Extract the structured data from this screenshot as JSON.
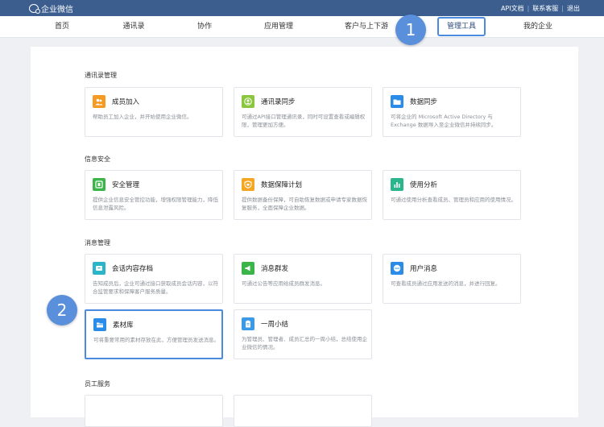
{
  "topbar": {
    "logo_text": "企业微信",
    "links": [
      "API文档",
      "联系客服",
      "退出"
    ],
    "separator": "|"
  },
  "nav": {
    "items": [
      {
        "label": "首页"
      },
      {
        "label": "通讯录"
      },
      {
        "label": "协作"
      },
      {
        "label": "应用管理"
      },
      {
        "label": "客户与上下游"
      },
      {
        "label": "管理工具",
        "active": true
      },
      {
        "label": "我的企业"
      }
    ]
  },
  "sections": [
    {
      "title": "通讯录管理",
      "cards": [
        {
          "title": "成员加入",
          "desc": "帮助员工加入企业，并开始使用企业微信。",
          "icon": "users-icon",
          "color": "#f59a23"
        },
        {
          "title": "通讯录同步",
          "desc": "可通过API接口管理通讯录，同时可设置查看或编辑权限，管理更加方便。",
          "icon": "user-sync-icon",
          "color": "#8cc63f"
        },
        {
          "title": "数据同步",
          "desc": "可将企业的 Microsoft Active Directory 与 Exchange 数据导入至企业微信并持续同步。",
          "icon": "folder-icon",
          "color": "#2a8ce8"
        }
      ]
    },
    {
      "title": "信息安全",
      "cards": [
        {
          "title": "安全管理",
          "desc": "提供企业信息安全管控功能，增强权限管理能力，降低信息泄露风险。",
          "icon": "shield-icon",
          "color": "#3bb54a"
        },
        {
          "title": "数据保障计划",
          "desc": "提供数据备份保障，可自助恢复数据或申请专家数据恢复服务，全面保障企业数据。",
          "icon": "data-shield-icon",
          "color": "#f5a623"
        },
        {
          "title": "使用分析",
          "desc": "可通过使用分析查看成员、管理员和应用的使用情况。",
          "icon": "bar-chart-icon",
          "color": "#2bb58c"
        }
      ]
    },
    {
      "title": "消息管理",
      "cards": [
        {
          "title": "会话内容存档",
          "desc": "告知成员后，企业可通过接口获取成员会话内容，以符合监管要求和保障客户服务质量。",
          "icon": "archive-icon",
          "color": "#2bb5c8"
        },
        {
          "title": "消息群发",
          "desc": "可通过公告等应用给成员群发消息。",
          "icon": "megaphone-icon",
          "color": "#3bb54a"
        },
        {
          "title": "用户消息",
          "desc": "可查看成员通过应用发送的消息，并进行回复。",
          "icon": "chat-icon",
          "color": "#2a8ce8"
        },
        {
          "title": "素材库",
          "desc": "可将重要常用的素材存放在此，方便管理员发送消息。",
          "icon": "library-icon",
          "color": "#2a8ce8",
          "highlight": true
        },
        {
          "title": "一周小结",
          "desc": "为管理员、管理者、成员汇总的一周小结，总结使用企业微信的情况。",
          "icon": "clipboard-icon",
          "color": "#3b9ae8"
        }
      ]
    },
    {
      "title": "员工服务",
      "cards": []
    }
  ],
  "badges": [
    "1",
    "2"
  ]
}
